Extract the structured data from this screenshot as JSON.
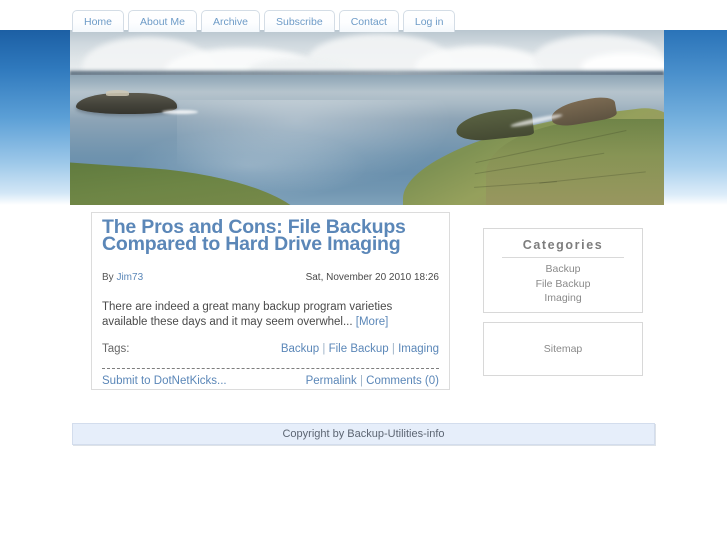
{
  "nav": {
    "tabs": [
      {
        "label": "Home"
      },
      {
        "label": "About Me"
      },
      {
        "label": "Archive"
      },
      {
        "label": "Subscribe"
      },
      {
        "label": "Contact"
      },
      {
        "label": "Log in"
      }
    ]
  },
  "banner": {
    "alt": "coastal seascape with rocky islet and green headland"
  },
  "post": {
    "title": "The Pros and Cons: File Backups Compared to Hard Drive Imaging",
    "author_label": "By ",
    "author": "Jim73",
    "date": "Sat, November 20 2010 18:26",
    "excerpt": "There are indeed a great many backup program varieties available these days and it may seem overwhel... ",
    "more_label": "[More]",
    "tags_label": "Tags:",
    "tags": [
      "Backup",
      "File Backup",
      "Imaging"
    ],
    "tag_separator": " | ",
    "submit_label": "Submit to DotNetKicks...",
    "permalink_label": "Permalink",
    "comments_label": "Comments (0)",
    "footer_separator": " | "
  },
  "sidebar": {
    "categories": {
      "title": "Categories",
      "items": [
        "Backup",
        "File Backup",
        "Imaging"
      ]
    },
    "sitemap": {
      "label": "Sitemap"
    }
  },
  "footer": {
    "text": "Copyright by Backup-Utilities-info"
  },
  "colors": {
    "link": "#5b87b8",
    "title": "#5b87b8",
    "footer_bg": "#e6eefa",
    "band_top": "#1c5fa4",
    "muted_text": "#8a8a8a"
  }
}
